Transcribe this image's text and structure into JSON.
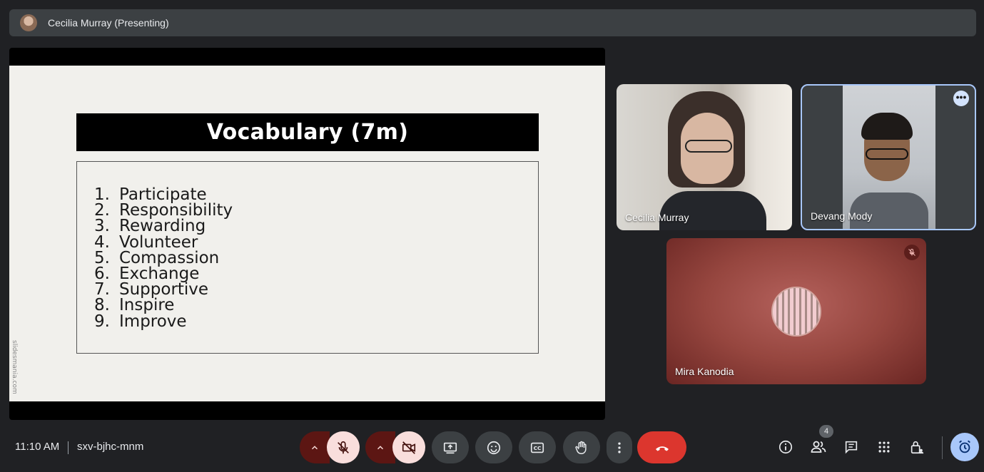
{
  "presenter": {
    "label": "Cecilia Murray (Presenting)"
  },
  "slide": {
    "title": "Vocabulary (7m)",
    "watermark": "slidesmania.com",
    "items": [
      {
        "num": "1.",
        "word": "Participate"
      },
      {
        "num": "2.",
        "word": "Responsibility"
      },
      {
        "num": "3.",
        "word": "Rewarding"
      },
      {
        "num": "4.",
        "word": "Volunteer"
      },
      {
        "num": "5.",
        "word": "Compassion"
      },
      {
        "num": "6.",
        "word": "Exchange"
      },
      {
        "num": "7.",
        "word": "Supportive"
      },
      {
        "num": "8.",
        "word": "Inspire"
      },
      {
        "num": "9.",
        "word": "Improve"
      }
    ]
  },
  "participants": [
    {
      "name": "Cecilia Murray"
    },
    {
      "name": "Devang Mody"
    },
    {
      "name": "Mira Kanodia"
    }
  ],
  "footer": {
    "time": "11:10 AM",
    "meeting_code": "sxv-bjhc-mnm",
    "people_count": "4"
  },
  "icons": {
    "presenter_avatar": "user-avatar-icon",
    "mic": "mic-off-icon",
    "camera": "video-off-icon",
    "present": "present-screen-icon",
    "emoji": "emoji-icon",
    "captions": "captions-icon",
    "hand": "raise-hand-icon",
    "more": "more-vert-icon",
    "end_call": "end-call-icon",
    "info": "info-icon",
    "people": "people-icon",
    "chat": "chat-icon",
    "activities": "apps-grid-icon",
    "host_controls": "lock-person-icon",
    "timer": "alarm-icon"
  },
  "colors": {
    "background": "#202124",
    "end_call": "#dc362e",
    "mic_off_bg": "#f9dedc",
    "accent": "#a8c7fa"
  }
}
